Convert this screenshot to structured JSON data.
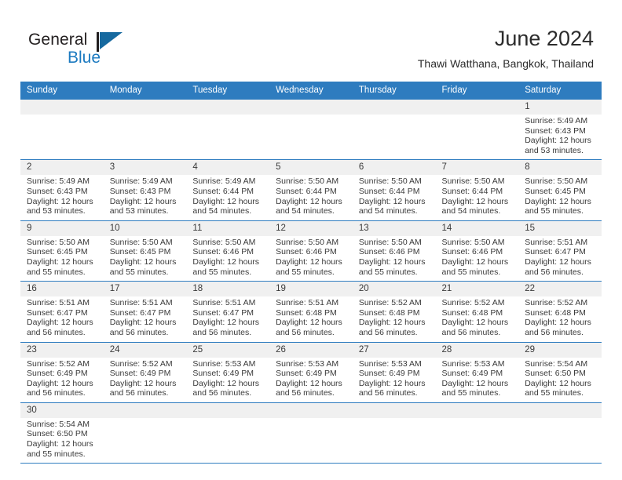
{
  "brand": {
    "name_part1": "General",
    "name_part2": "Blue",
    "accent_color": "#1c7ac0",
    "flag_icon": "triangle-flag-icon"
  },
  "header": {
    "title": "June 2024",
    "subtitle": "Thawi Watthana, Bangkok, Thailand",
    "header_bg": "#2e7cbf",
    "daynum_bg": "#f0f0f0"
  },
  "weekday_headers": [
    "Sunday",
    "Monday",
    "Tuesday",
    "Wednesday",
    "Thursday",
    "Friday",
    "Saturday"
  ],
  "labels": {
    "sunrise_prefix": "Sunrise:",
    "sunset_prefix": "Sunset:",
    "daylight_prefix": "Daylight:"
  },
  "weeks": [
    [
      {
        "blank": true
      },
      {
        "blank": true
      },
      {
        "blank": true
      },
      {
        "blank": true
      },
      {
        "blank": true
      },
      {
        "blank": true
      },
      {
        "day": "1",
        "sunrise": "Sunrise: 5:49 AM",
        "sunset": "Sunset: 6:43 PM",
        "daylight": "Daylight: 12 hours and 53 minutes."
      }
    ],
    [
      {
        "day": "2",
        "sunrise": "Sunrise: 5:49 AM",
        "sunset": "Sunset: 6:43 PM",
        "daylight": "Daylight: 12 hours and 53 minutes."
      },
      {
        "day": "3",
        "sunrise": "Sunrise: 5:49 AM",
        "sunset": "Sunset: 6:43 PM",
        "daylight": "Daylight: 12 hours and 53 minutes."
      },
      {
        "day": "4",
        "sunrise": "Sunrise: 5:49 AM",
        "sunset": "Sunset: 6:44 PM",
        "daylight": "Daylight: 12 hours and 54 minutes."
      },
      {
        "day": "5",
        "sunrise": "Sunrise: 5:50 AM",
        "sunset": "Sunset: 6:44 PM",
        "daylight": "Daylight: 12 hours and 54 minutes."
      },
      {
        "day": "6",
        "sunrise": "Sunrise: 5:50 AM",
        "sunset": "Sunset: 6:44 PM",
        "daylight": "Daylight: 12 hours and 54 minutes."
      },
      {
        "day": "7",
        "sunrise": "Sunrise: 5:50 AM",
        "sunset": "Sunset: 6:44 PM",
        "daylight": "Daylight: 12 hours and 54 minutes."
      },
      {
        "day": "8",
        "sunrise": "Sunrise: 5:50 AM",
        "sunset": "Sunset: 6:45 PM",
        "daylight": "Daylight: 12 hours and 55 minutes."
      }
    ],
    [
      {
        "day": "9",
        "sunrise": "Sunrise: 5:50 AM",
        "sunset": "Sunset: 6:45 PM",
        "daylight": "Daylight: 12 hours and 55 minutes."
      },
      {
        "day": "10",
        "sunrise": "Sunrise: 5:50 AM",
        "sunset": "Sunset: 6:45 PM",
        "daylight": "Daylight: 12 hours and 55 minutes."
      },
      {
        "day": "11",
        "sunrise": "Sunrise: 5:50 AM",
        "sunset": "Sunset: 6:46 PM",
        "daylight": "Daylight: 12 hours and 55 minutes."
      },
      {
        "day": "12",
        "sunrise": "Sunrise: 5:50 AM",
        "sunset": "Sunset: 6:46 PM",
        "daylight": "Daylight: 12 hours and 55 minutes."
      },
      {
        "day": "13",
        "sunrise": "Sunrise: 5:50 AM",
        "sunset": "Sunset: 6:46 PM",
        "daylight": "Daylight: 12 hours and 55 minutes."
      },
      {
        "day": "14",
        "sunrise": "Sunrise: 5:50 AM",
        "sunset": "Sunset: 6:46 PM",
        "daylight": "Daylight: 12 hours and 55 minutes."
      },
      {
        "day": "15",
        "sunrise": "Sunrise: 5:51 AM",
        "sunset": "Sunset: 6:47 PM",
        "daylight": "Daylight: 12 hours and 56 minutes."
      }
    ],
    [
      {
        "day": "16",
        "sunrise": "Sunrise: 5:51 AM",
        "sunset": "Sunset: 6:47 PM",
        "daylight": "Daylight: 12 hours and 56 minutes."
      },
      {
        "day": "17",
        "sunrise": "Sunrise: 5:51 AM",
        "sunset": "Sunset: 6:47 PM",
        "daylight": "Daylight: 12 hours and 56 minutes."
      },
      {
        "day": "18",
        "sunrise": "Sunrise: 5:51 AM",
        "sunset": "Sunset: 6:47 PM",
        "daylight": "Daylight: 12 hours and 56 minutes."
      },
      {
        "day": "19",
        "sunrise": "Sunrise: 5:51 AM",
        "sunset": "Sunset: 6:48 PM",
        "daylight": "Daylight: 12 hours and 56 minutes."
      },
      {
        "day": "20",
        "sunrise": "Sunrise: 5:52 AM",
        "sunset": "Sunset: 6:48 PM",
        "daylight": "Daylight: 12 hours and 56 minutes."
      },
      {
        "day": "21",
        "sunrise": "Sunrise: 5:52 AM",
        "sunset": "Sunset: 6:48 PM",
        "daylight": "Daylight: 12 hours and 56 minutes."
      },
      {
        "day": "22",
        "sunrise": "Sunrise: 5:52 AM",
        "sunset": "Sunset: 6:48 PM",
        "daylight": "Daylight: 12 hours and 56 minutes."
      }
    ],
    [
      {
        "day": "23",
        "sunrise": "Sunrise: 5:52 AM",
        "sunset": "Sunset: 6:49 PM",
        "daylight": "Daylight: 12 hours and 56 minutes."
      },
      {
        "day": "24",
        "sunrise": "Sunrise: 5:52 AM",
        "sunset": "Sunset: 6:49 PM",
        "daylight": "Daylight: 12 hours and 56 minutes."
      },
      {
        "day": "25",
        "sunrise": "Sunrise: 5:53 AM",
        "sunset": "Sunset: 6:49 PM",
        "daylight": "Daylight: 12 hours and 56 minutes."
      },
      {
        "day": "26",
        "sunrise": "Sunrise: 5:53 AM",
        "sunset": "Sunset: 6:49 PM",
        "daylight": "Daylight: 12 hours and 56 minutes."
      },
      {
        "day": "27",
        "sunrise": "Sunrise: 5:53 AM",
        "sunset": "Sunset: 6:49 PM",
        "daylight": "Daylight: 12 hours and 56 minutes."
      },
      {
        "day": "28",
        "sunrise": "Sunrise: 5:53 AM",
        "sunset": "Sunset: 6:49 PM",
        "daylight": "Daylight: 12 hours and 55 minutes."
      },
      {
        "day": "29",
        "sunrise": "Sunrise: 5:54 AM",
        "sunset": "Sunset: 6:50 PM",
        "daylight": "Daylight: 12 hours and 55 minutes."
      }
    ],
    [
      {
        "day": "30",
        "sunrise": "Sunrise: 5:54 AM",
        "sunset": "Sunset: 6:50 PM",
        "daylight": "Daylight: 12 hours and 55 minutes."
      },
      {
        "blank": true
      },
      {
        "blank": true
      },
      {
        "blank": true
      },
      {
        "blank": true
      },
      {
        "blank": true
      },
      {
        "blank": true
      }
    ]
  ]
}
